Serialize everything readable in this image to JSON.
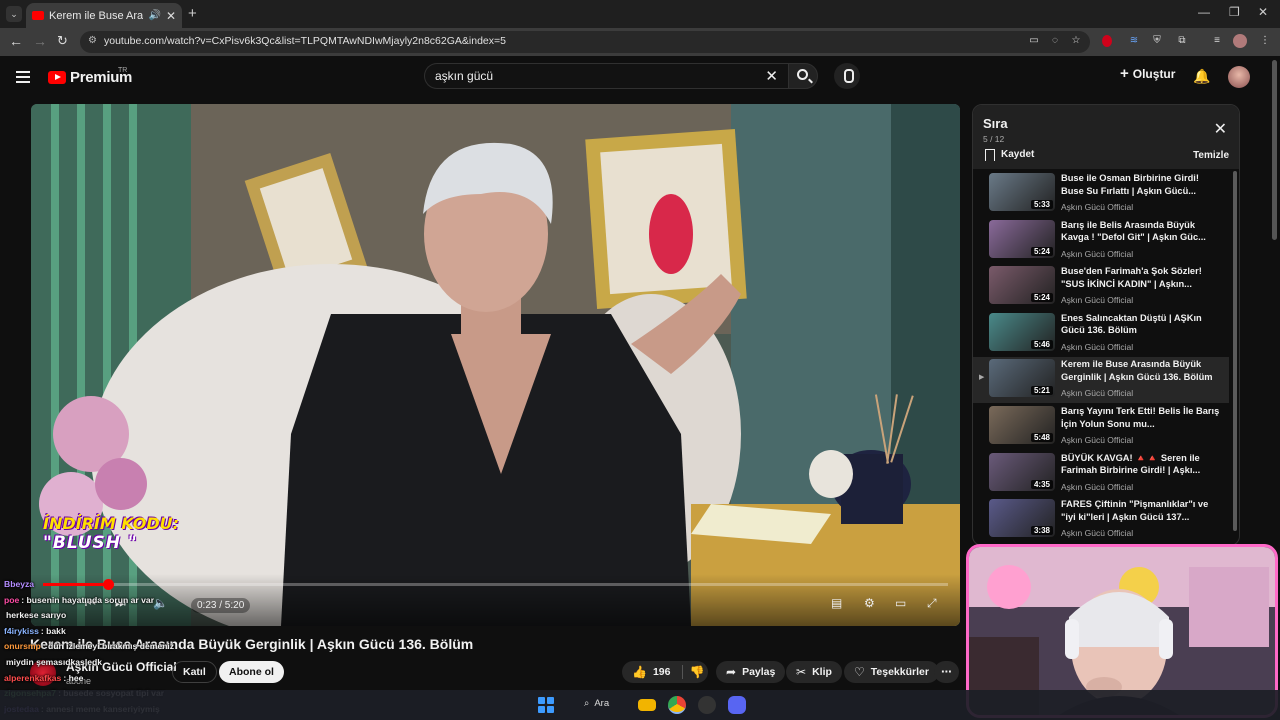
{
  "browser": {
    "tab_title": "Kerem ile Buse Arasında Bü",
    "url": "youtube.com/watch?v=CxPisv6k3Qc&list=TLPQMTAwNDIwMjayly2n8c62GA&index=5"
  },
  "header": {
    "logo_text": "Premium",
    "region": "TR",
    "search_value": "aşkın gücü",
    "create_label": "Oluştur"
  },
  "video": {
    "promo_line1": "İNDİRİM KODU:",
    "promo_line2": "\"BLUSH \"",
    "time": "0:23 / 5:20",
    "progress": 0.072,
    "title": "Kerem ile Buse Arasında Büyük Gerginlik | Aşkın Gücü 136. Bölüm",
    "channel": "Aşkın Gücü Official",
    "subs": "abone",
    "join_label": "Katıl",
    "subscribe_label": "Abone ol",
    "likes": "196",
    "share_label": "Paylaş",
    "clip_label": "Klip",
    "thanks_label": "Teşekkürler"
  },
  "playlist": {
    "title": "Sıra",
    "count": "5 / 12",
    "save_label": "Kaydet",
    "clear_label": "Temizle",
    "items": [
      {
        "title": "Buse ile Osman Birbirine Girdi! Buse Su Fırlattı | Aşkın Gücü...",
        "channel": "Aşkın Gücü Official",
        "duration": "5:33",
        "color": "#6a7a88"
      },
      {
        "title": "Barış ile Belis Arasında Büyük Kavga ! \"Defol Git\" | Aşkın Güc...",
        "channel": "Aşkın Gücü Official",
        "duration": "5:24",
        "color": "#8a6a9a"
      },
      {
        "title": "Buse'den Farimah'a Şok Sözler! \"SUS İKİNCİ KADIN\" | Aşkın...",
        "channel": "Aşkın Gücü Official",
        "duration": "5:24",
        "color": "#7a5a6a"
      },
      {
        "title": "Enes Salıncaktan Düştü | AŞKın Gücü 136. Bölüm",
        "channel": "Aşkın Gücü Official",
        "duration": "5:46",
        "color": "#4a8a8a"
      },
      {
        "title": "Kerem ile Buse Arasında Büyük Gerginlik | Aşkın Gücü 136. Bölüm",
        "channel": "Aşkın Gücü Official",
        "duration": "5:21",
        "color": "#5a6a7a"
      },
      {
        "title": "Barış Yayını Terk Etti! Belis İle Barış İçin Yolun Sonu mu...",
        "channel": "Aşkın Gücü Official",
        "duration": "5:48",
        "color": "#7a6a5a"
      },
      {
        "title": "BÜYÜK KAVGA! 🔺🔺 Seren ile Farimah Birbirine Girdi! | Aşkı...",
        "channel": "Aşkın Gücü Official",
        "duration": "4:35",
        "color": "#6a5a7a"
      },
      {
        "title": "FARES Çiftinin \"Pişmanlıklar\"ı ve \"iyi ki\"leri | Aşkın Gücü 137...",
        "channel": "Aşkın Gücü Official",
        "duration": "3:38",
        "color": "#5a5a8a"
      }
    ]
  },
  "chat": [
    {
      "user": "Bbeyza",
      "color": "#b48cff",
      "msg": ""
    },
    {
      "user": "poe",
      "color": "#ff4da6",
      "msg": ": busenin hayatında sorun ar var"
    },
    {
      "user": "",
      "color": "#ffffff",
      "msg": "herkese sarıyo"
    },
    {
      "user": "f4irykiss",
      "color": "#8ab4ff",
      "msg": ": bakk"
    },
    {
      "user": "onursmp",
      "color": "#ff9a3c",
      "msg": ": dün izlemeyi bırakmış demeniz"
    },
    {
      "user": "",
      "color": "#ffffff",
      "msg": "miydin şemasıdkasledk"
    },
    {
      "user": "alperenkafkas",
      "color": "#ff4d4d",
      "msg": ": hee"
    },
    {
      "user": "zigonsehpa7",
      "color": "#7adf7a",
      "msg": ": busede sosyopat tipi var"
    },
    {
      "user": "jostedaa",
      "color": "#a08cff",
      "msg": ": annesi meme kanseriyiymiş"
    }
  ],
  "taskbar": {
    "search_label": "Ara"
  }
}
